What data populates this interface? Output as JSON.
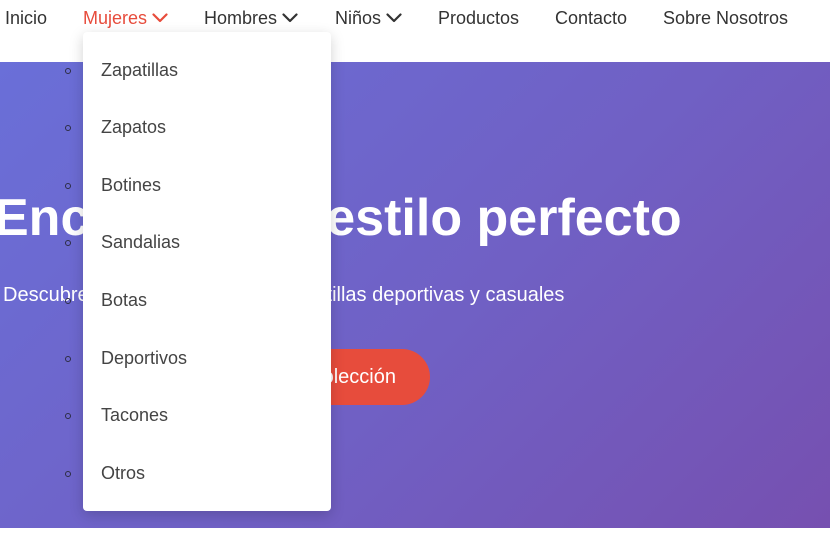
{
  "nav": {
    "items": [
      {
        "label": "Inicio"
      },
      {
        "label": "Mujeres"
      },
      {
        "label": "Hombres"
      },
      {
        "label": "Niños"
      },
      {
        "label": "Productos"
      },
      {
        "label": "Contacto"
      },
      {
        "label": "Sobre Nosotros"
      }
    ],
    "active_item": "Mujeres"
  },
  "dropdown": {
    "items": [
      {
        "label": "Zapatillas"
      },
      {
        "label": "Zapatos"
      },
      {
        "label": "Botines"
      },
      {
        "label": "Sandalias"
      },
      {
        "label": "Botas"
      },
      {
        "label": "Deportivos"
      },
      {
        "label": "Tacones"
      },
      {
        "label": "Otros"
      }
    ]
  },
  "hero": {
    "title": "Encuentra tu estilo perfecto",
    "subtitle": "Descubre nuestra colección de zapatillas deportivas y casuales",
    "cta_label": "Ver Colección"
  },
  "colors": {
    "accent": "#e74c3c",
    "hero_gradient_start": "#6a6fd8",
    "hero_gradient_end": "#7650b0",
    "nav_text": "#333333"
  },
  "icons": {
    "nav_dropdown": "chevron-down-icon"
  }
}
